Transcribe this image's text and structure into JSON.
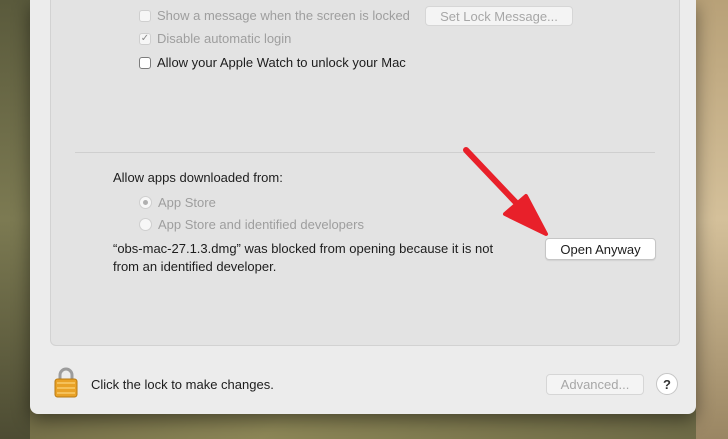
{
  "security": {
    "show_message_label": "Show a message when the screen is locked",
    "set_lock_message_label": "Set Lock Message...",
    "disable_auto_login_label": "Disable automatic login",
    "apple_watch_label": "Allow your Apple Watch to unlock your Mac",
    "allow_apps_label": "Allow apps downloaded from:",
    "option_app_store": "App Store",
    "option_identified_devs": "App Store and identified developers",
    "blocked_message_line1": "“obs-mac-27.1.3.dmg” was blocked from opening because it is not",
    "blocked_message_line2": "from an identified developer.",
    "open_anyway_label": "Open Anyway"
  },
  "footer": {
    "lock_text": "Click the lock to make changes.",
    "advanced_label": "Advanced...",
    "help_label": "?"
  },
  "colors": {
    "annotation_arrow": "#e8202a",
    "window_bg": "#ececec",
    "panel_bg": "#e3e3e3"
  },
  "icons": {
    "lock": "lock-icon",
    "arrow": "red-arrow-annotation",
    "check": "checkmark-icon"
  }
}
